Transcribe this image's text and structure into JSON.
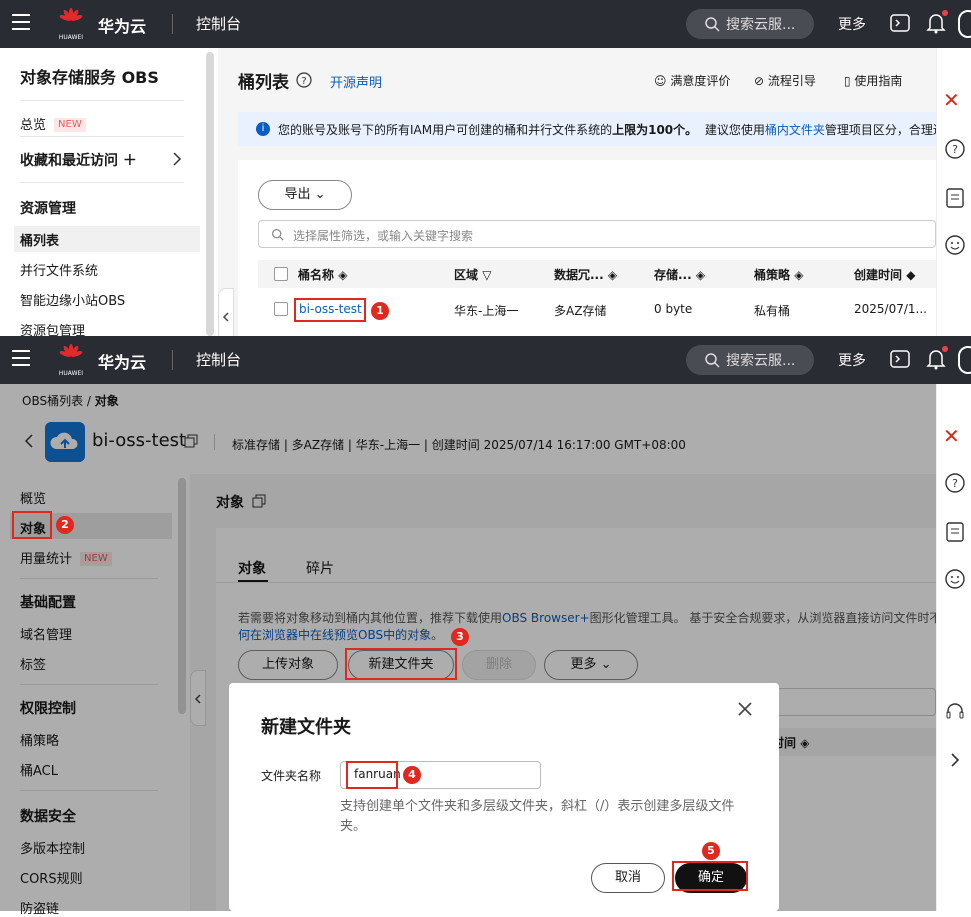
{
  "header": {
    "brand": "华为云",
    "logo_text": "HUAWEI",
    "console": "控制台",
    "search_placeholder": "搜索云服...",
    "more": "更多"
  },
  "panel1": {
    "sidebar": {
      "title": "对象存储服务 OBS",
      "overview": "总览",
      "new_badge": "NEW",
      "favorites": "收藏和最近访问 ＋",
      "section": "资源管理",
      "items": [
        "桶列表",
        "并行文件系统",
        "智能边缘小站OBS",
        "资源包管理"
      ]
    },
    "page_title": "桶列表",
    "open_source": "开源声明",
    "top_links": [
      "满意度评价",
      "流程引导",
      "使用指南"
    ],
    "info_pre": "您的账号及账号下的所有IAM用户可创建的桶和并行文件系统的",
    "info_bold": "上限为100个。",
    "info_mid": "建议您使用",
    "info_link": "桶内文件夹",
    "info_post": "管理项目区分，合理进",
    "export_btn": "导出",
    "filter_placeholder": "选择属性筛选，或输入关键字搜索",
    "table_headers": [
      "桶名称",
      "区域",
      "数据冗...",
      "存储...",
      "桶策略",
      "创建时间"
    ],
    "row": {
      "name": "bi-oss-test",
      "region": "华东-上海一",
      "redundancy": "多AZ存储",
      "storage": "0 byte",
      "policy": "私有桶",
      "created": "2025/07/1..."
    }
  },
  "panel2": {
    "breadcrumb_root": "OBS桶列表",
    "breadcrumb_current": "对象",
    "bucket_name": "bi-oss-test",
    "bucket_meta": "标准存储 | 多AZ存储 | 华东-上海一 | 创建时间  2025/07/14 16:17:00 GMT+08:00",
    "sidebar": {
      "items_top": [
        "概览",
        "对象",
        "用量统计"
      ],
      "new_badge": "NEW",
      "sec1": "基础配置",
      "sec1_items": [
        "域名管理",
        "标签"
      ],
      "sec2": "权限控制",
      "sec2_items": [
        "桶策略",
        "桶ACL"
      ],
      "sec3": "数据安全",
      "sec3_items": [
        "多版本控制",
        "CORS规则",
        "防盗链"
      ]
    },
    "section_title": "对象",
    "tabs": [
      "对象",
      "碎片"
    ],
    "tip_line1": "若需要将对象移动到桶内其他位置，推荐下载使用",
    "tip_link1": "OBS Browser+",
    "tip_line1b": "图形化管理工具。 基于安全合规要求，从浏览器直接访问文件时不",
    "tip_link2": "何在浏览器中在线预览OBS中的对象",
    "tip_end": "。",
    "buttons": [
      "上传对象",
      "新建文件夹",
      "删除",
      "更多"
    ],
    "col_partial": "时间"
  },
  "dialog": {
    "title": "新建文件夹",
    "label": "文件夹名称",
    "value": "fanruan",
    "help": "支持创建单个文件夹和多层级文件夹，斜杠（/）表示创建多层级文件夹。",
    "cancel": "取消",
    "confirm": "确定"
  },
  "steps": [
    "1",
    "2",
    "3",
    "4",
    "5"
  ]
}
